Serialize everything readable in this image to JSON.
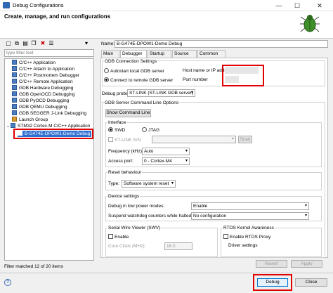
{
  "window": {
    "title": "Debug Configurations",
    "min": "—",
    "max": "☐",
    "close": "✕"
  },
  "header": {
    "title": "Create, manage, and run configurations"
  },
  "toolbar": {
    "icons": [
      "new-config-icon",
      "duplicate-icon",
      "export-icon",
      "copy-icon",
      "delete-icon",
      "filter-icon",
      "collapse-all-icon"
    ],
    "glyphs": [
      "▢",
      "⧉",
      "▤",
      "❐",
      "✖",
      "☰",
      "▾"
    ]
  },
  "filter": {
    "placeholder": "type filter text",
    "status": "Filter matched 12 of 20 items"
  },
  "tree": {
    "items": [
      {
        "label": "C/C++ Application"
      },
      {
        "label": "C/C++ Attach to Application"
      },
      {
        "label": "C/C++ Postmortem Debugger"
      },
      {
        "label": "C/C++ Remote Application"
      },
      {
        "label": "GDB Hardware Debugging"
      },
      {
        "label": "GDB OpenOCD Debugging"
      },
      {
        "label": "GDB PyOCD Debugging"
      },
      {
        "label": "GDB QEMU Debugging"
      },
      {
        "label": "GDB SEGGER J-Link Debugging"
      },
      {
        "label": "Launch Group"
      },
      {
        "label": "STM32 Cortex-M C/C++ Application"
      },
      {
        "label": "B-G474E-DPOW1-Demo Debug"
      }
    ]
  },
  "name": {
    "label": "Name:",
    "value": "B-G474E-DPOW1-Demo Debug"
  },
  "tabs": [
    "Main",
    "Debugger",
    "Startup",
    "Source",
    "Common"
  ],
  "gdb": {
    "title": "GDB Connection Settings",
    "autostart": "Autostart local GDB server",
    "connect": "Connect to remote GDB server",
    "host_label": "Host name or IP address",
    "port_label": "Port number"
  },
  "probe": {
    "label": "Debug probe",
    "value": "ST-LINK (ST-LINK GDB server)"
  },
  "server_opts": {
    "title": "GDB Server Command Line Options",
    "show_btn": "Show Command Line"
  },
  "interface": {
    "title": "Interface",
    "swd": "SWD",
    "jtag": "JTAG",
    "stlink_sn": "ST-LINK S/N",
    "scan": "Scan",
    "freq_label": "Frequency (kHz):",
    "freq_value": "Auto",
    "port_label": "Access port:",
    "port_value": "0 - Cortex-M4"
  },
  "reset": {
    "title": "Reset behaviour",
    "type_label": "Type:",
    "type_value": "Software system reset"
  },
  "device": {
    "title": "Device settings",
    "lowpower_label": "Debug in low power modes:",
    "lowpower_value": "Enable",
    "watchdog_label": "Suspend watchdog counters while halted:",
    "watchdog_value": "No configuration"
  },
  "swv": {
    "title": "Serial Wire Viewer (SWV)",
    "enable": "Enable",
    "clock_label": "Core Clock (MHz):",
    "clock_value": "16.0"
  },
  "rtos": {
    "title": "RTOS Kernel Awareness",
    "enable": "Enable RTOS Proxy",
    "driver": "Driver settings"
  },
  "buttons": {
    "revert": "Revert",
    "apply": "Apply",
    "debug": "Debug",
    "close": "Close"
  }
}
